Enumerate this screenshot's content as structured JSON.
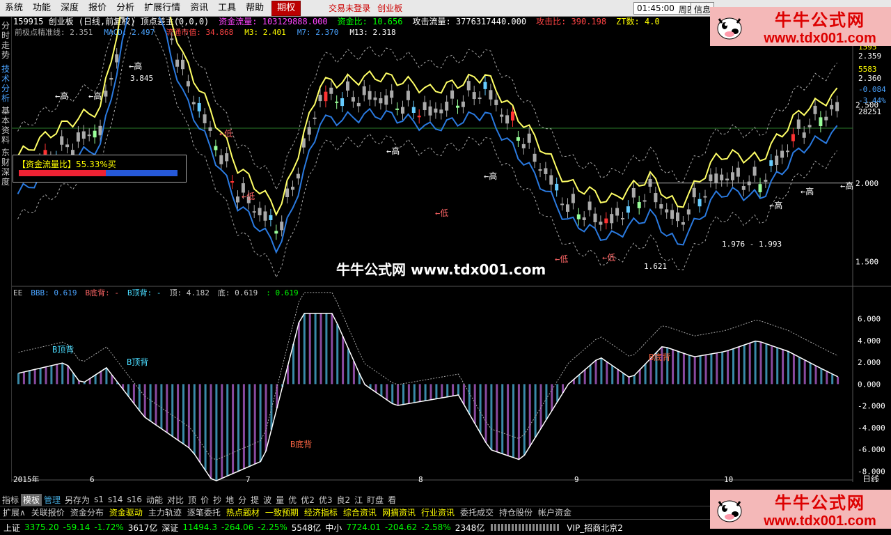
{
  "menu": {
    "items": [
      "系统",
      "功能",
      "深度",
      "报价",
      "分析",
      "扩展行情",
      "资讯",
      "工具",
      "帮助"
    ],
    "active_tab": "期权",
    "hint_login": "交易未登录",
    "hint_board": "创业板",
    "time": "01:45:00",
    "weekday": "周四",
    "info": "信息"
  },
  "left_tabs": [
    "分时走势",
    "技术分析",
    "基本资料",
    "东财深度"
  ],
  "header": {
    "row1": [
      {
        "text": "159915 创业板 (日线,前复权) 顶点差主(0,0,0)",
        "color": "#ffffff"
      },
      {
        "text": "资金流量: 103129888.000",
        "color": "#ff44ff"
      },
      {
        "text": "资金比: 10.656",
        "color": "#00ff00"
      },
      {
        "text": "攻击流量: 3776317440.000",
        "color": "#ffffff"
      },
      {
        "text": "攻击比: 390.198",
        "color": "#ff4444"
      },
      {
        "text": "ZT数: 4.0",
        "color": "#ffff00"
      }
    ],
    "row2": [
      {
        "text": "前极点精准线: 2.351",
        "color": "#aaaaaa"
      },
      {
        "text": "MACD: 2.497",
        "color": "#4aa3ff"
      },
      {
        "text": "流通市值: 34.868",
        "color": "#ff4444"
      },
      {
        "text": "M3: 2.401",
        "color": "#ffff00"
      },
      {
        "text": "M7: 2.370",
        "color": "#4aa3ff"
      },
      {
        "text": "M13: 2.318",
        "color": "#ffffff"
      }
    ]
  },
  "price_axis": [
    {
      "label": "2.500",
      "color": "#ffffff",
      "value": 2.5
    },
    {
      "label": "2.000",
      "color": "#ffffff",
      "value": 2.0
    },
    {
      "label": "1.500",
      "color": "#ffffff",
      "value": 1.5
    }
  ],
  "side_stats": [
    {
      "label": "1595",
      "color": "#ffff00"
    },
    {
      "label": "2.359",
      "color": "#ffffff"
    },
    {
      "label": "5583",
      "color": "#ffff00"
    },
    {
      "label": "2.360",
      "color": "#ffffff"
    },
    {
      "label": "-0.084",
      "color": "#4aa3ff"
    },
    {
      "label": "-3.44%",
      "color": "#4aa3ff"
    },
    {
      "label": "28251",
      "color": "#ffffff"
    }
  ],
  "annotations_high": [
    "高",
    "高",
    "高",
    "高",
    "高",
    "高",
    "高",
    "高"
  ],
  "annotations_low": [
    "低",
    "低",
    "低",
    "低",
    "低"
  ],
  "price_labels": [
    "3.845",
    "1.976 - 1.993",
    "1.621"
  ],
  "flow_box": {
    "label": "【资金流量比】55.33%买",
    "red_fraction": 0.55
  },
  "center_watermark": "牛牛公式网 www.tdx001.com",
  "indicator_header": [
    {
      "text": "EE",
      "color": "#cccccc"
    },
    {
      "text": "BBB: 0.619",
      "color": "#4aa3ff"
    },
    {
      "text": "B底背: -",
      "color": "#ff6666"
    },
    {
      "text": "B顶背: -",
      "color": "#4adcff"
    },
    {
      "text": "顶: 4.182",
      "color": "#cccccc"
    },
    {
      "text": "底: 0.619",
      "color": "#cccccc"
    },
    {
      "text": ": 0.619",
      "color": "#00ff00"
    }
  ],
  "indicator_axis": [
    "6.000",
    "4.000",
    "2.000",
    "0.000",
    "-2.000",
    "-4.000",
    "-6.000",
    "-8.000"
  ],
  "indicator_labels": {
    "top_div1": "B顶背",
    "top_div2": "B顶背",
    "bot_div1": "B底背",
    "bot_div2": "B底背"
  },
  "time_axis": {
    "labels": [
      "2015年",
      "6",
      "7",
      "8",
      "9",
      "10"
    ],
    "period": "日线"
  },
  "bottom_bar1": [
    "指标",
    "模板",
    "管理",
    "另存为",
    "s1",
    "s14",
    "s16",
    "动能",
    "对比",
    "顶",
    "价",
    "抄",
    "地",
    "分",
    "提",
    "波",
    "量",
    "优",
    "优2",
    "优3",
    "良2",
    "江",
    "盯盘",
    "看"
  ],
  "bottom_bar1_active": "模板",
  "bottom_bar1_highlight": "管理",
  "bottom_bar2": [
    "扩展∧",
    "关联报价",
    "资金分布",
    "资金驱动",
    "主力轨迹",
    "逐笔委托",
    "热点题材",
    "一致预期",
    "经济指标",
    "综合资讯",
    "网摘资讯",
    "行业资讯",
    "委托成交",
    "持仓股份",
    "帐户资金"
  ],
  "bottom_bar2_yellow": [
    "资金驱动",
    "热点题材",
    "一致预期",
    "经济指标",
    "综合资讯",
    "网摘资讯",
    "行业资讯"
  ],
  "status": {
    "sh_label": "上证",
    "sh_value": "3375.20",
    "sh_change": "-59.14",
    "sh_pct": "-1.72%",
    "sh_vol": "3617亿",
    "sz_label": "深证",
    "sz_value": "11494.3",
    "sz_change": "-264.06",
    "sz_pct": "-2.25%",
    "sz_vol": "5548亿",
    "zx_label": "中小",
    "zx_value": "7724.01",
    "zx_change": "-204.62",
    "zx_pct": "-2.58%",
    "zx_vol": "2348亿",
    "broker": "VIP_招商北京2"
  },
  "watermark": {
    "title": "牛牛公式网",
    "url": "www.tdx001.com"
  },
  "chart_data": {
    "type": "candlestick",
    "price_ylim": [
      1.35,
      2.95
    ],
    "indicator_ylim": [
      -9,
      7
    ],
    "highs_of_note": [
      3.845
    ],
    "lows_of_note": [
      1.621
    ]
  }
}
